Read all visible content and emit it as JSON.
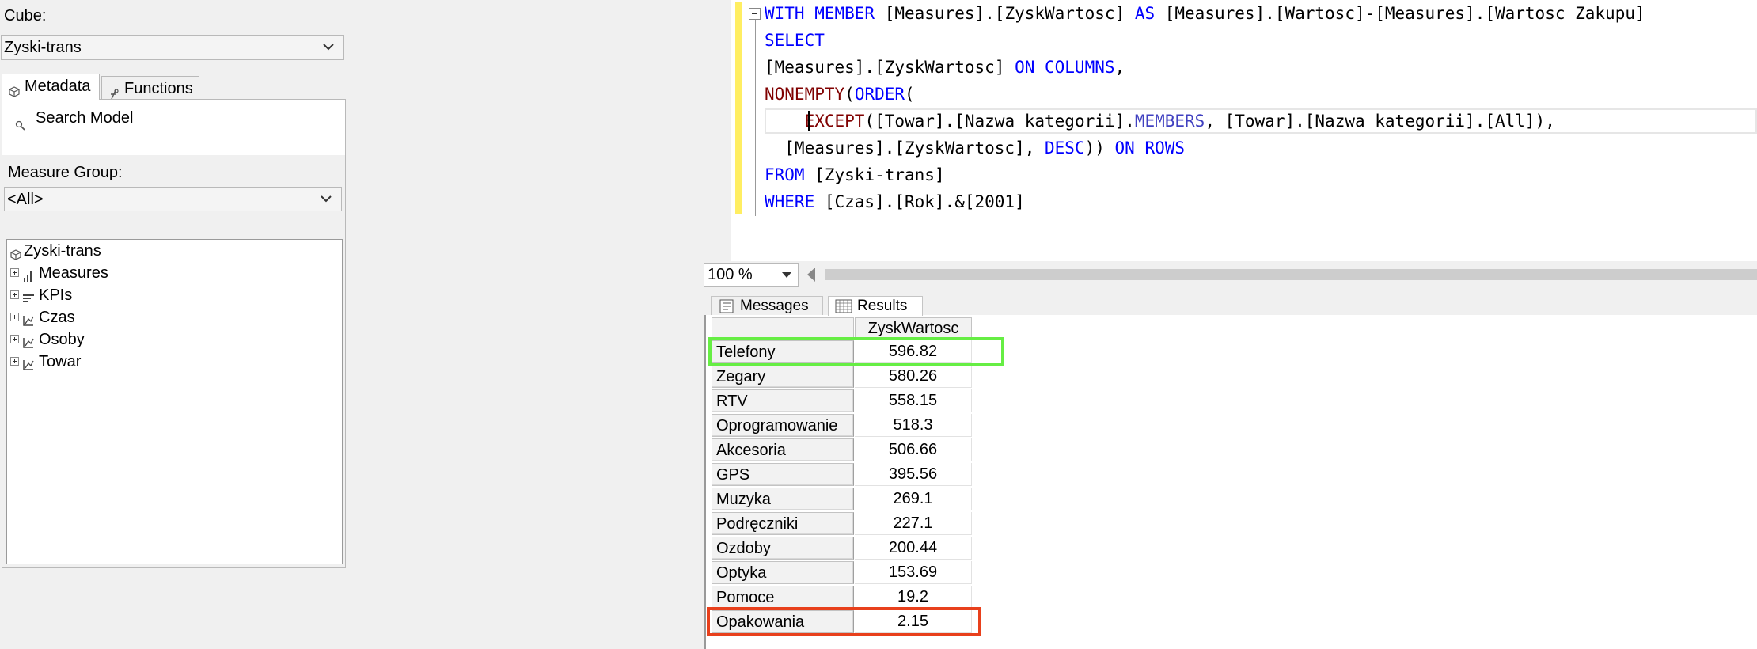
{
  "left_panel": {
    "cube_label": "Cube:",
    "cube_value": "Zyski-trans",
    "tabs": [
      {
        "label": "Metadata",
        "icon": "cube-icon",
        "active": true
      },
      {
        "label": "Functions",
        "icon": "function-icon",
        "active": false
      }
    ],
    "search_label": "Search Model",
    "measure_group_label": "Measure Group:",
    "measure_group_value": "<All>",
    "tree": {
      "root": "Zyski-trans",
      "items": [
        {
          "label": "Measures",
          "icon": "measures-icon"
        },
        {
          "label": "KPIs",
          "icon": "kpi-icon"
        },
        {
          "label": "Czas",
          "icon": "dimension-icon"
        },
        {
          "label": "Osoby",
          "icon": "dimension-icon"
        },
        {
          "label": "Towar",
          "icon": "dimension-icon"
        }
      ]
    }
  },
  "editor": {
    "lines": [
      [
        {
          "t": "WITH MEMBER",
          "c": "kw"
        },
        {
          "t": " [Measures].[ZyskWartosc] ",
          "c": "id"
        },
        {
          "t": "AS",
          "c": "kw"
        },
        {
          "t": " [Measures].[Wartosc]-[Measures].[Wartosc Zakupu]",
          "c": "id"
        }
      ],
      [
        {
          "t": "SELECT",
          "c": "kw"
        }
      ],
      [
        {
          "t": "[Measures].[ZyskWartosc] ",
          "c": "id"
        },
        {
          "t": "ON COLUMNS",
          "c": "kw"
        },
        {
          "t": ",",
          "c": "id"
        }
      ],
      [
        {
          "t": "NONEMPTY",
          "c": "fn"
        },
        {
          "t": "(",
          "c": "id"
        },
        {
          "t": "ORDER",
          "c": "kw"
        },
        {
          "t": "(",
          "c": "id"
        }
      ],
      [
        {
          "t": "    ",
          "c": "id"
        },
        {
          "t": "EXCEPT",
          "c": "fn"
        },
        {
          "t": "([Towar].[Nazwa kategorii].",
          "c": "id"
        },
        {
          "t": "MEMBERS",
          "c": "ct"
        },
        {
          "t": ", [Towar].[Nazwa kategorii].[All]),",
          "c": "id"
        }
      ],
      [
        {
          "t": "  [Measures].[ZyskWartosc], ",
          "c": "id"
        },
        {
          "t": "DESC",
          "c": "kw"
        },
        {
          "t": ")) ",
          "c": "id"
        },
        {
          "t": "ON ROWS",
          "c": "kw"
        }
      ],
      [
        {
          "t": "FROM",
          "c": "kw"
        },
        {
          "t": " [Zyski-trans]",
          "c": "id"
        }
      ],
      [
        {
          "t": "WHERE",
          "c": "kw"
        },
        {
          "t": " [Czas].[Rok].&[2001]",
          "c": "id"
        }
      ]
    ]
  },
  "zoom": {
    "value": "100 %"
  },
  "results_tabs": [
    {
      "label": "Messages",
      "icon": "messages-icon"
    },
    {
      "label": "Results",
      "icon": "grid-icon",
      "active": true
    }
  ],
  "results": {
    "column": "ZyskWartosc",
    "rows": [
      {
        "category": "Telefony",
        "value": "596.82"
      },
      {
        "category": "Zegary",
        "value": "580.26"
      },
      {
        "category": "RTV",
        "value": "558.15"
      },
      {
        "category": "Oprogramowanie",
        "value": "518.3"
      },
      {
        "category": "Akcesoria",
        "value": "506.66"
      },
      {
        "category": "GPS",
        "value": "395.56"
      },
      {
        "category": "Muzyka",
        "value": "269.1"
      },
      {
        "category": "Podręczniki",
        "value": "227.1"
      },
      {
        "category": "Ozdoby",
        "value": "200.44"
      },
      {
        "category": "Optyka",
        "value": "153.69"
      },
      {
        "category": "Pomoce",
        "value": "19.2"
      },
      {
        "category": "Opakowania",
        "value": "2.15"
      }
    ]
  },
  "highlights": {
    "top_color": "#66ee44",
    "bottom_color": "#e8401c"
  }
}
